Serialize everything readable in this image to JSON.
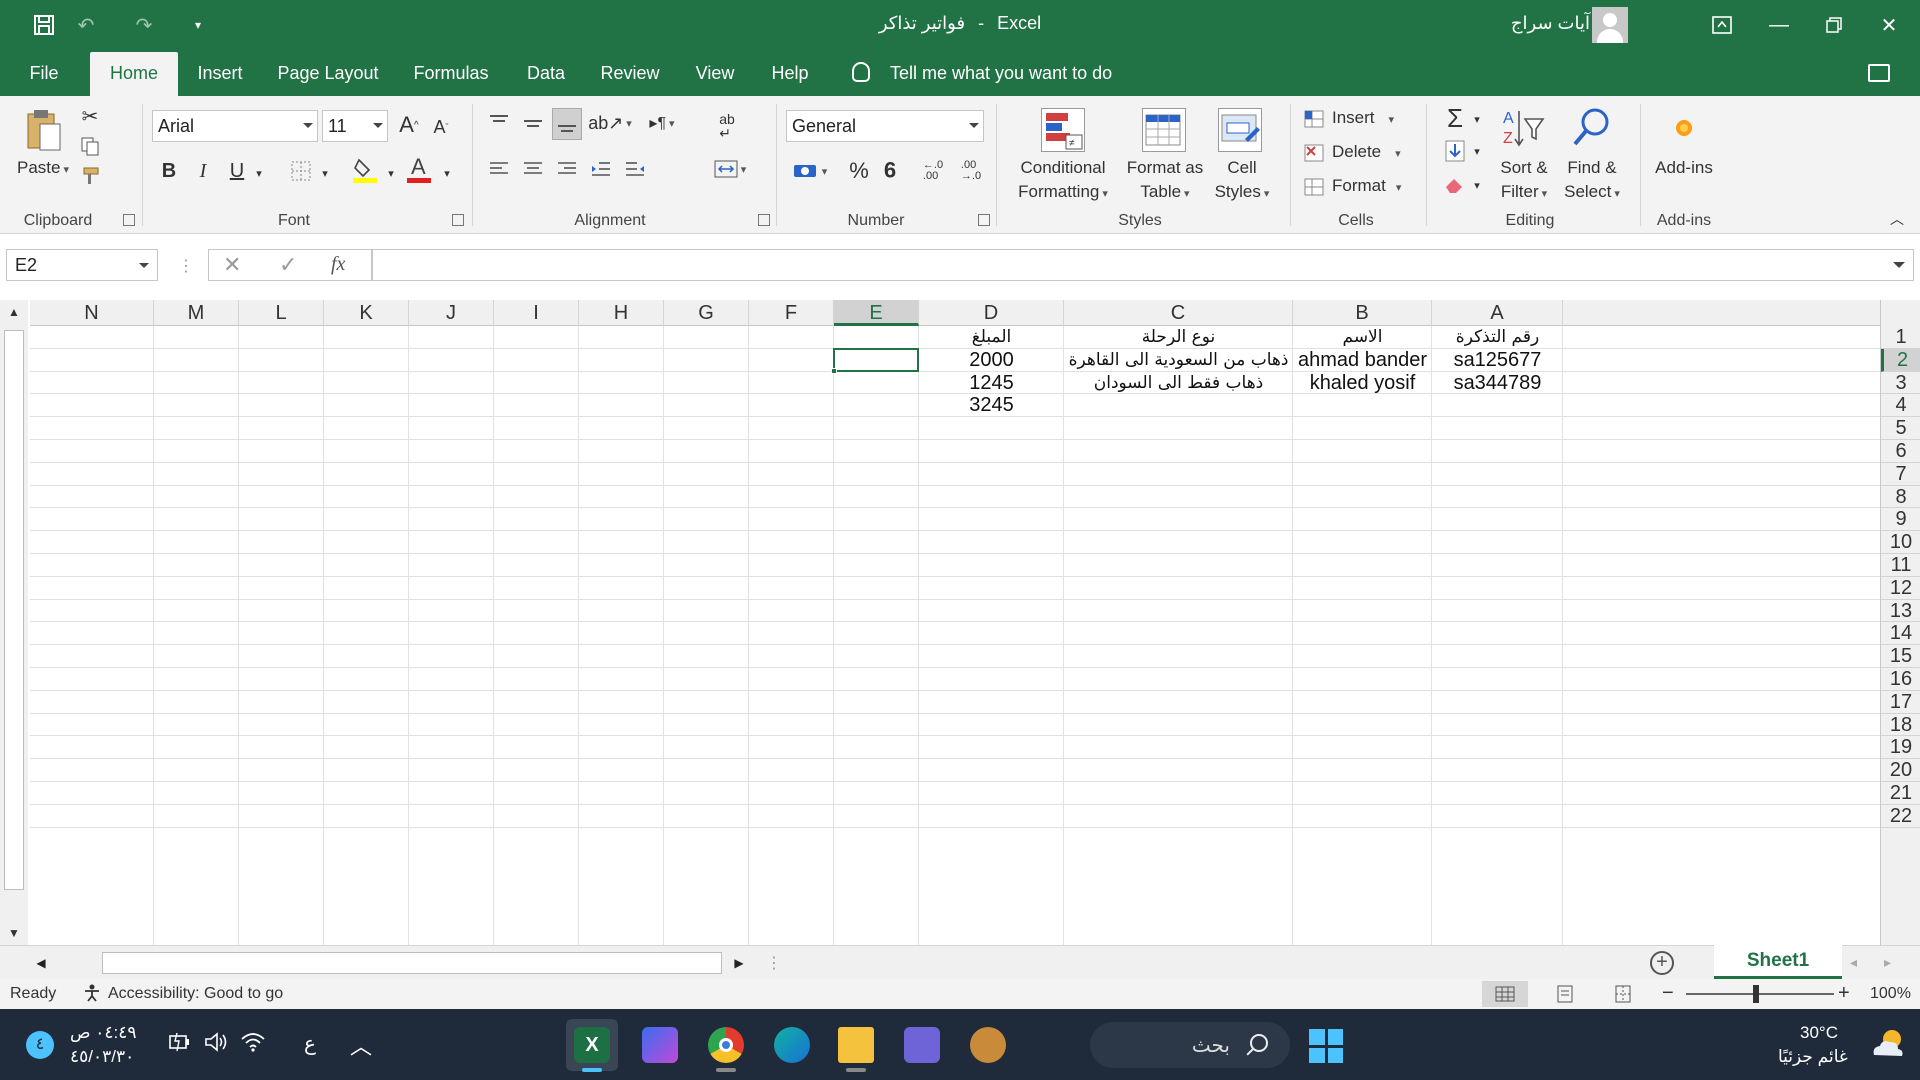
{
  "window": {
    "doc_title": "فواتير تذاكر",
    "app_name": "Excel",
    "title_separator": "-",
    "user_name": "آيات سراج"
  },
  "quick_access": [
    "save-icon",
    "undo-icon",
    "redo-icon",
    "customize-icon"
  ],
  "tabs": [
    {
      "label": "File"
    },
    {
      "label": "Home",
      "active": true
    },
    {
      "label": "Insert"
    },
    {
      "label": "Page Layout"
    },
    {
      "label": "Formulas"
    },
    {
      "label": "Data"
    },
    {
      "label": "Review"
    },
    {
      "label": "View"
    },
    {
      "label": "Help"
    }
  ],
  "tell_me": "Tell me what you want to do",
  "ribbon": {
    "clipboard": {
      "label": "Clipboard",
      "paste": "Paste"
    },
    "font": {
      "label": "Font",
      "name": "Arial",
      "size": "11",
      "bold": "B",
      "italic": "I",
      "underline": "U"
    },
    "alignment": {
      "label": "Alignment"
    },
    "number": {
      "label": "Number",
      "format": "General",
      "percent": "%",
      "comma": "9"
    },
    "styles": {
      "label": "Styles",
      "conditional_1": "Conditional",
      "conditional_2": "Formatting",
      "format_table_1": "Format as",
      "format_table_2": "Table",
      "cell_styles_1": "Cell",
      "cell_styles_2": "Styles"
    },
    "cells": {
      "label": "Cells",
      "insert": "Insert",
      "delete": "Delete",
      "format": "Format"
    },
    "editing": {
      "label": "Editing",
      "sort_1": "Sort &",
      "sort_2": "Filter",
      "find_1": "Find &",
      "find_2": "Select"
    },
    "addins": {
      "label": "Add-ins",
      "button": "Add-ins"
    }
  },
  "formula_bar": {
    "name_box": "E2",
    "fx": "fx",
    "value": ""
  },
  "columns": [
    "N",
    "M",
    "L",
    "K",
    "J",
    "I",
    "H",
    "G",
    "F",
    "E",
    "D",
    "C",
    "B",
    "A"
  ],
  "selected_column": "E",
  "rows": [
    "1",
    "2",
    "3",
    "4",
    "5",
    "6",
    "7",
    "8",
    "9",
    "10",
    "11",
    "12",
    "13",
    "14",
    "15",
    "16",
    "17",
    "18",
    "19",
    "20",
    "21",
    "22"
  ],
  "selected_row": "2",
  "sheet": {
    "headers": {
      "A": "رقم التذكرة",
      "B": "الاسم",
      "C": "نوع الرحلة",
      "D": "المبلغ"
    },
    "data": [
      {
        "A": "sa125677",
        "B": "ahmad bander",
        "C": "ذهاب من السعودية الى القاهرة",
        "D": "2000"
      },
      {
        "A": "sa344789",
        "B": "khaled yosif",
        "C": "ذهاب فقط الى السودان",
        "D": "1245"
      }
    ],
    "total": {
      "D": "3245"
    }
  },
  "sheet_tabs": [
    {
      "label": "Sheet1",
      "active": true
    }
  ],
  "status": {
    "ready": "Ready",
    "accessibility": "Accessibility: Good to go",
    "zoom": "100%",
    "zoom_minus": "−",
    "zoom_plus": "+"
  },
  "taskbar": {
    "weather_temp": "30°C",
    "weather_desc": "غائم جزئيًا",
    "search": "بحث",
    "time": "٠٤:٤٩ ص",
    "date": "٤٥/٠٣/٣٠",
    "lang": "ع",
    "notif": "٤"
  },
  "colors": {
    "excel_green": "#217346",
    "ribbon_bg": "#f3f3f3",
    "taskbar_bg": "#1f2b3a"
  }
}
